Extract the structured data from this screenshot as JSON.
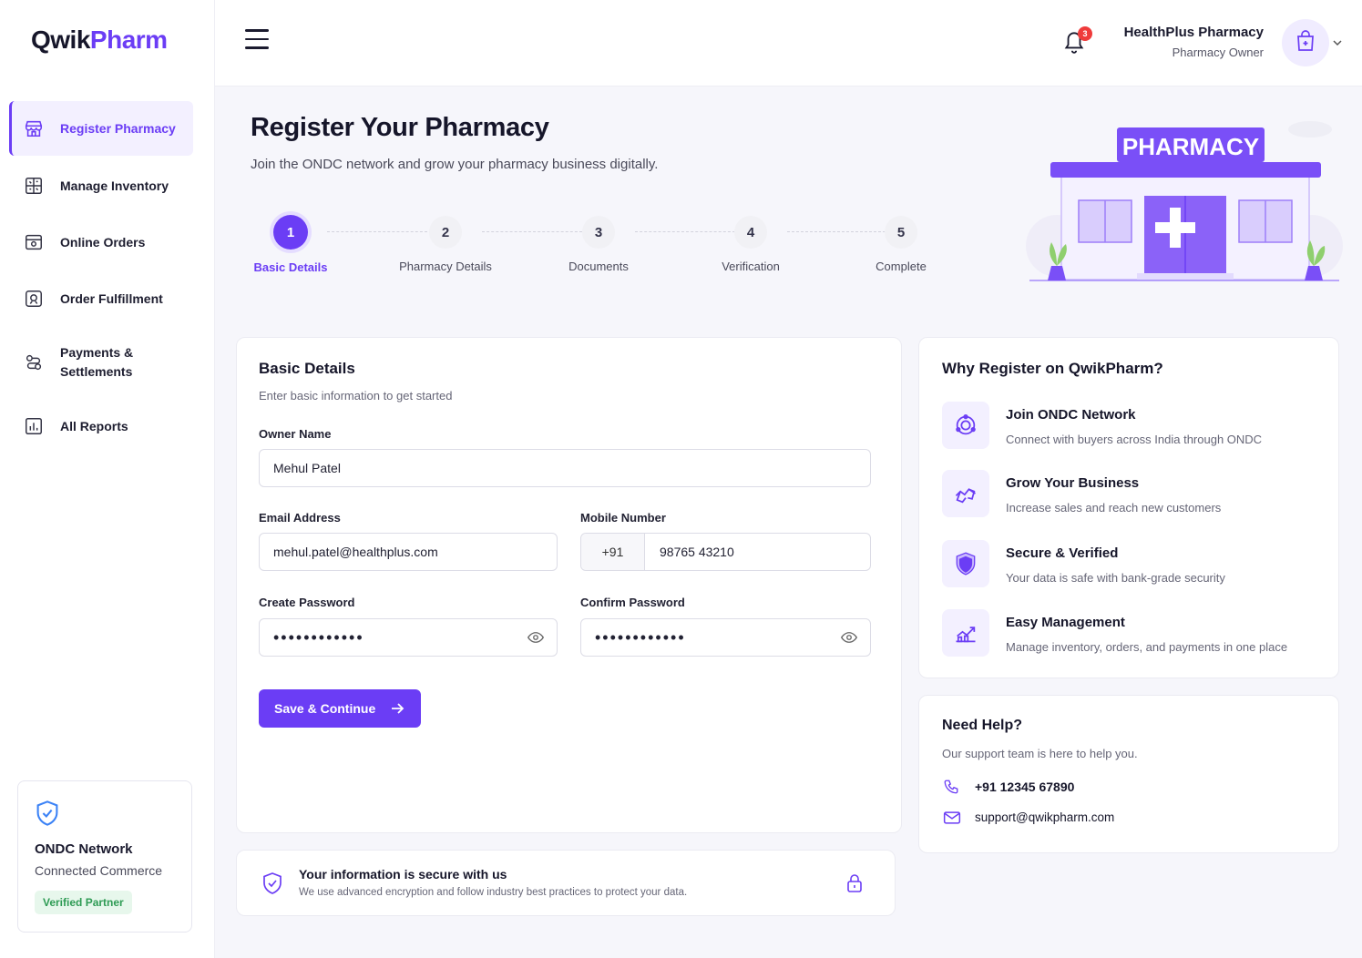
{
  "brand": {
    "part1": "Qwik",
    "part2": "Pharm"
  },
  "sidebar": {
    "items": [
      {
        "label": "Register Pharmacy",
        "icon": "store-icon",
        "active": true
      },
      {
        "label": "Manage Inventory",
        "icon": "inventory-icon"
      },
      {
        "label": "Online Orders",
        "icon": "orders-icon"
      },
      {
        "label": "Order Fulfillment",
        "icon": "fulfillment-icon"
      },
      {
        "label": "Payments & Settlements",
        "icon": "payments-icon"
      },
      {
        "label": "All Reports",
        "icon": "reports-icon"
      }
    ],
    "ondc": {
      "title": "ONDC Network",
      "subtitle": "Connected Commerce",
      "badge": "Verified Partner"
    }
  },
  "topbar": {
    "notifications": "3",
    "user_name": "HealthPlus Pharmacy",
    "user_role": "Pharmacy Owner"
  },
  "hero": {
    "title": "Register Your Pharmacy",
    "subtitle": "Join the ONDC network and grow your pharmacy business digitally.",
    "illustration_sign": "PHARMACY"
  },
  "steps": [
    {
      "num": "1",
      "label": "Basic Details",
      "active": true
    },
    {
      "num": "2",
      "label": "Pharmacy Details"
    },
    {
      "num": "3",
      "label": "Documents"
    },
    {
      "num": "4",
      "label": "Verification"
    },
    {
      "num": "5",
      "label": "Complete"
    }
  ],
  "form": {
    "title": "Basic Details",
    "subtitle": "Enter basic information to get started",
    "owner_label": "Owner Name",
    "owner_value": "Mehul Patel",
    "email_label": "Email Address",
    "email_value": "mehul.patel@healthplus.com",
    "mobile_label": "Mobile Number",
    "mobile_prefix": "+91",
    "mobile_value": "98765 43210",
    "password_label": "Create Password",
    "password_value": "••••••••••••",
    "confirm_label": "Confirm Password",
    "confirm_value": "••••••••••••",
    "submit_label": "Save & Continue"
  },
  "secure_note": {
    "title": "Your information is secure with us",
    "text": "We use advanced encryption and follow industry best practices to protect your data."
  },
  "why": {
    "title": "Why Register on QwikPharm?",
    "items": [
      {
        "title": "Join ONDC Network",
        "desc": "Connect with buyers across India through ONDC",
        "icon": "network-icon"
      },
      {
        "title": "Grow Your Business",
        "desc": "Increase sales and reach new customers",
        "icon": "handshake-icon"
      },
      {
        "title": "Secure & Verified",
        "desc": "Your data is safe with bank-grade security",
        "icon": "shield-icon"
      },
      {
        "title": "Easy Management",
        "desc": "Manage inventory, orders, and payments in one place",
        "icon": "growth-chart-icon"
      }
    ]
  },
  "help": {
    "title": "Need Help?",
    "subtitle": "Our support team is here to help you.",
    "phone": "+91 12345 67890",
    "email": "support@qwikpharm.com"
  },
  "colors": {
    "accent": "#6b3df5",
    "badge_green": "#2e9b54",
    "notify_red": "#ef3b3b"
  }
}
